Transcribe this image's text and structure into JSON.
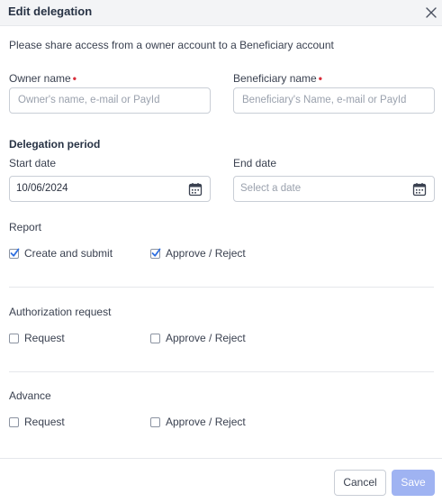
{
  "dialog": {
    "title": "Edit delegation",
    "intro": "Please share access from a owner account to a Beneficiary account"
  },
  "owner": {
    "label": "Owner name",
    "required_mark": "•",
    "placeholder": "Owner's name, e-mail or PayId"
  },
  "beneficiary": {
    "label": "Beneficiary name",
    "required_mark": "•",
    "placeholder": "Beneficiary's Name, e-mail or PayId"
  },
  "delegation_period": {
    "title": "Delegation period",
    "start_label": "Start date",
    "start_value": "10/06/2024",
    "end_label": "End date",
    "end_placeholder": "Select a date"
  },
  "report": {
    "title": "Report",
    "options": [
      {
        "label": "Create and submit",
        "checked": true
      },
      {
        "label": "Approve / Reject",
        "checked": true
      }
    ]
  },
  "authorization": {
    "title": "Authorization request",
    "options": [
      {
        "label": "Request",
        "checked": false
      },
      {
        "label": "Approve / Reject",
        "checked": false
      }
    ]
  },
  "advance": {
    "title": "Advance",
    "options": [
      {
        "label": "Request",
        "checked": false
      },
      {
        "label": "Approve / Reject",
        "checked": false
      }
    ]
  },
  "footer": {
    "cancel_label": "Cancel",
    "save_label": "Save"
  },
  "colors": {
    "accent": "#2f6fe0",
    "save_disabled": "#9fb3f2",
    "required": "#d92d3a"
  },
  "icons": {
    "close": "close-icon",
    "calendar": "calendar-icon",
    "check": "check-icon"
  }
}
